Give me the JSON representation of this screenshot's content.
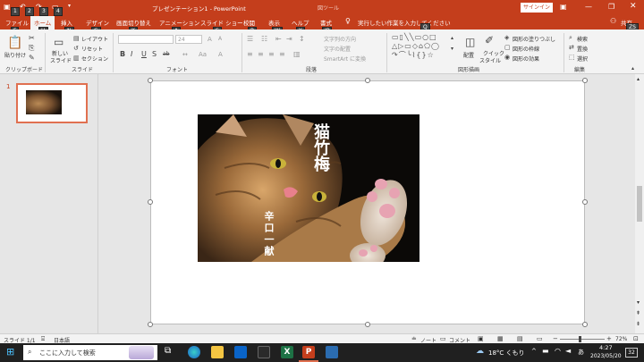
{
  "titlebar": {
    "title": "プレゼンテーション1  -  PowerPoint",
    "context_tool": "図ツール",
    "signin": "サインイン",
    "qat_keys": [
      "1",
      "2",
      "3",
      "4"
    ]
  },
  "tabs": [
    {
      "label": "ファイル",
      "key": "F"
    },
    {
      "label": "ホーム",
      "key": "H"
    },
    {
      "label": "挿入",
      "key": "N"
    },
    {
      "label": "デザイン",
      "key": "G"
    },
    {
      "label": "画面切り替え",
      "key": "K"
    },
    {
      "label": "アニメーション",
      "key": "A"
    },
    {
      "label": "スライド ショー",
      "key": "S"
    },
    {
      "label": "校閲",
      "key": "R"
    },
    {
      "label": "表示",
      "key": "W"
    },
    {
      "label": "ヘルプ",
      "key": "Y"
    },
    {
      "label": "書式",
      "key": "JP"
    }
  ],
  "tellme": {
    "placeholder": "実行したい作業を入力してください",
    "key": "Q"
  },
  "share": {
    "label": "共有",
    "key": "ZS"
  },
  "ribbon": {
    "clipboard": {
      "paste": "貼り付け",
      "group": "クリップボード"
    },
    "slides": {
      "new_slide": "新しい",
      "new_slide2": "スライド",
      "layout": "レイアウト",
      "reset": "リセット",
      "section": "セクション",
      "group": "スライド"
    },
    "font": {
      "size": "24",
      "group": "フォント",
      "buttons": [
        "B",
        "I",
        "U",
        "S",
        "ab"
      ]
    },
    "paragraph": {
      "direction": "文字列の方向",
      "align": "文字の配置",
      "smartart": "SmartArt に変換",
      "group": "段落"
    },
    "drawing": {
      "arrange": "配置",
      "quick_style": "クイック",
      "quick_style2": "スタイル",
      "fill": "図形の塗りつぶし",
      "outline": "図形の枠線",
      "effect": "図形の効果",
      "group": "図形描画"
    },
    "editing": {
      "find": "検索",
      "replace": "置換",
      "select": "選択",
      "group": "編集"
    }
  },
  "thumbnail": {
    "number": "1"
  },
  "slide": {
    "text_top": "猫竹梅",
    "text_bottom": "辛口一献"
  },
  "statusbar": {
    "slide_info": "スライド 1/1",
    "language": "日本語",
    "notes": "ノート",
    "comments": "コメント",
    "zoom": "72%",
    "zoom_level": 0.45
  },
  "taskbar": {
    "search_placeholder": "ここに入力して検索",
    "weather": "18°C くもり",
    "ime": "あ",
    "time": "4:27",
    "date": "2023/05/20",
    "notifications": "32"
  }
}
